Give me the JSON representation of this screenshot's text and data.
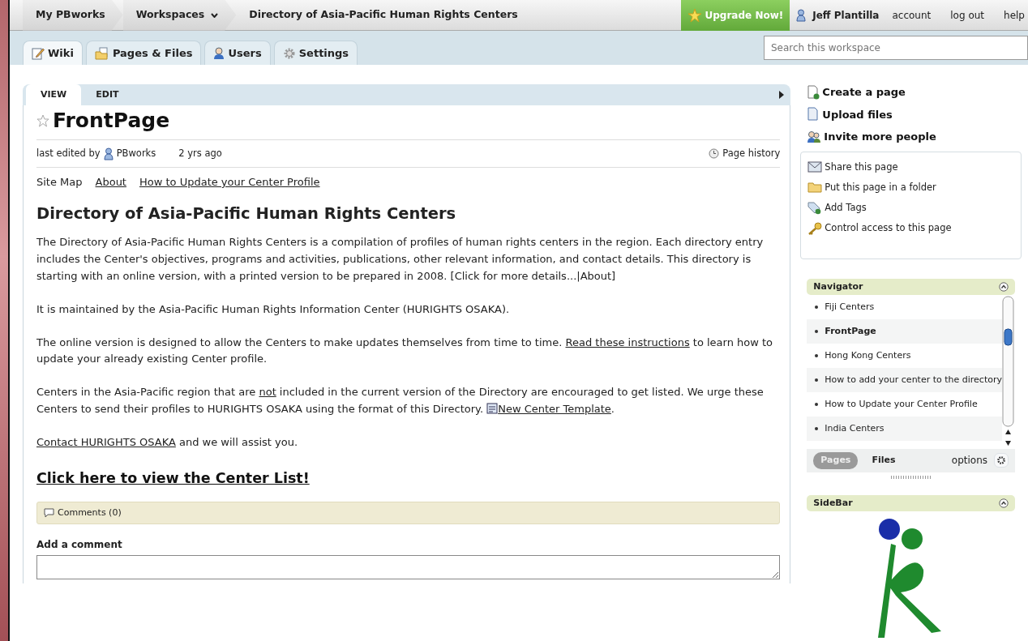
{
  "top_bar": {
    "breadcrumbs": [
      {
        "label": "My PBworks",
        "kind": "link"
      },
      {
        "label": "Workspaces",
        "kind": "dropdown"
      },
      {
        "label": "Directory of Asia-Pacific Human Rights Centers",
        "kind": "current"
      }
    ],
    "upgrade_button": "Upgrade Now!",
    "user_name": "Jeff Plantilla",
    "user_links": [
      "account",
      "log out",
      "help"
    ]
  },
  "workspace_tabs": [
    {
      "label": "Wiki",
      "selected": true
    },
    {
      "label": "Pages & Files",
      "selected": false
    },
    {
      "label": "Users",
      "selected": false
    },
    {
      "label": "Settings",
      "selected": false
    }
  ],
  "search": {
    "placeholder": "Search this workspace"
  },
  "page_tabs": [
    {
      "label": "VIEW",
      "selected": true
    },
    {
      "label": "EDIT",
      "selected": false
    }
  ],
  "page": {
    "title": "FrontPage",
    "starred": false,
    "edited_label": "last edited by",
    "editor": "PBworks",
    "edited_time": "2 yrs ago",
    "history_link": "Page history",
    "links": [
      {
        "label": "Site Map",
        "kind": "text"
      },
      {
        "label": "About",
        "kind": "link"
      },
      {
        "label": "How to Update your Center Profile",
        "kind": "link"
      }
    ],
    "heading": "Directory of Asia-Pacific Human Rights Centers",
    "paragraphs": [
      [
        {
          "kind": "text",
          "text": "The Directory of Asia-Pacific Human Rights Centers is a compilation of profiles of human rights centers in the region. Each directory entry includes the Center's objectives, programs and activities, publications, other relevant information, and contact details. This directory is starting with an online version, with a printed version to be prepared in 2008. [Click for more details...|About]"
        }
      ],
      [
        {
          "kind": "text",
          "text": "It is maintained by the Asia-Pacific Human Rights Information Center (HURIGHTS OSAKA)."
        }
      ],
      [
        {
          "kind": "text",
          "text": "The online version is designed to allow the Centers to make updates themselves from time to time. "
        },
        {
          "kind": "link",
          "text": "Read these instructions"
        },
        {
          "kind": "text",
          "text": " to learn how to update your already existing Center profile."
        }
      ],
      [
        {
          "kind": "text",
          "text": "Centers in the Asia-Pacific region that are "
        },
        {
          "kind": "underline",
          "text": "not"
        },
        {
          "kind": "text",
          "text": " included in the current version of the Directory are encouraged to get listed. We urge these Centers to send their profiles to HURIGHTS OSAKA using the format of this Directory. "
        },
        {
          "kind": "doc-link",
          "text": "New Center Template"
        },
        {
          "kind": "text",
          "text": "."
        }
      ],
      [
        {
          "kind": "link",
          "text": "Contact HURIGHTS OSAKA"
        },
        {
          "kind": "text",
          "text": " and we will assist you."
        }
      ]
    ],
    "big_link": "Click here to view the Center List!",
    "comments": "Comments (0)",
    "add_comment_label": "Add a comment"
  },
  "actions": [
    "Create a page",
    "Upload files",
    "Invite more people"
  ],
  "page_actions": [
    "Share this page",
    "Put this page in a folder",
    "Add Tags",
    "Control access to this page"
  ],
  "navigator": {
    "title": "Navigator",
    "items": [
      {
        "label": "Fiji Centers",
        "selected": false
      },
      {
        "label": "FrontPage",
        "selected": true
      },
      {
        "label": "Hong Kong Centers",
        "selected": false
      },
      {
        "label": "How to add your center to the directory",
        "selected": false
      },
      {
        "label": "How to Update your Center Profile",
        "selected": false
      },
      {
        "label": "India Centers",
        "selected": false
      }
    ],
    "views": [
      {
        "label": "Pages",
        "selected": true
      },
      {
        "label": "Files",
        "selected": false
      }
    ],
    "options": "options"
  },
  "sidebar_panel": {
    "title": "SideBar"
  }
}
